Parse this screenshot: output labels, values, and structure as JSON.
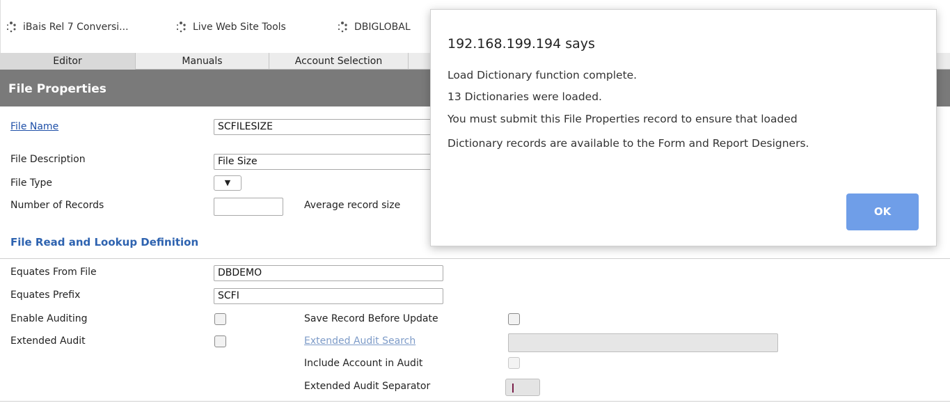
{
  "bookmarks": [
    {
      "label": "iBais Rel 7 Conversi...",
      "icon": "spinner-icon"
    },
    {
      "label": "Live Web Site Tools",
      "icon": "spinner-icon"
    },
    {
      "label": "DBIGLOBAL",
      "icon": "spinner-icon"
    }
  ],
  "tabs": [
    "Editor",
    "Manuals",
    "Account Selection"
  ],
  "section_title": "File Properties",
  "fields": {
    "file_name_label": "File Name",
    "file_name_value": "SCFILESIZE",
    "file_description_label": "File Description",
    "file_description_value": "File Size",
    "file_type_label": "File Type",
    "file_type_arrow": "▼",
    "number_of_records_label": "Number of Records",
    "average_record_size_label": "Average record size"
  },
  "subsection_title": "File Read and Lookup Definition",
  "lookup": {
    "equates_from_file_label": "Equates From File",
    "equates_from_file_value": "DBDEMO",
    "equates_prefix_label": "Equates Prefix",
    "equates_prefix_value": "SCFI",
    "enable_auditing_label": "Enable Auditing",
    "save_record_before_update_label": "Save Record Before Update",
    "extended_audit_label": "Extended Audit",
    "extended_audit_search_label": "Extended Audit Search",
    "include_account_in_audit_label": "Include Account in Audit",
    "extended_audit_separator_label": "Extended Audit Separator"
  },
  "dialog": {
    "host": "192.168.199.194 says",
    "lines": [
      "Load Dictionary function complete.",
      "13 Dictionaries were loaded.",
      "You must submit this File Properties record to ensure that loaded",
      "Dictionary records are available to the Form and Report Designers."
    ],
    "ok_label": "OK"
  }
}
